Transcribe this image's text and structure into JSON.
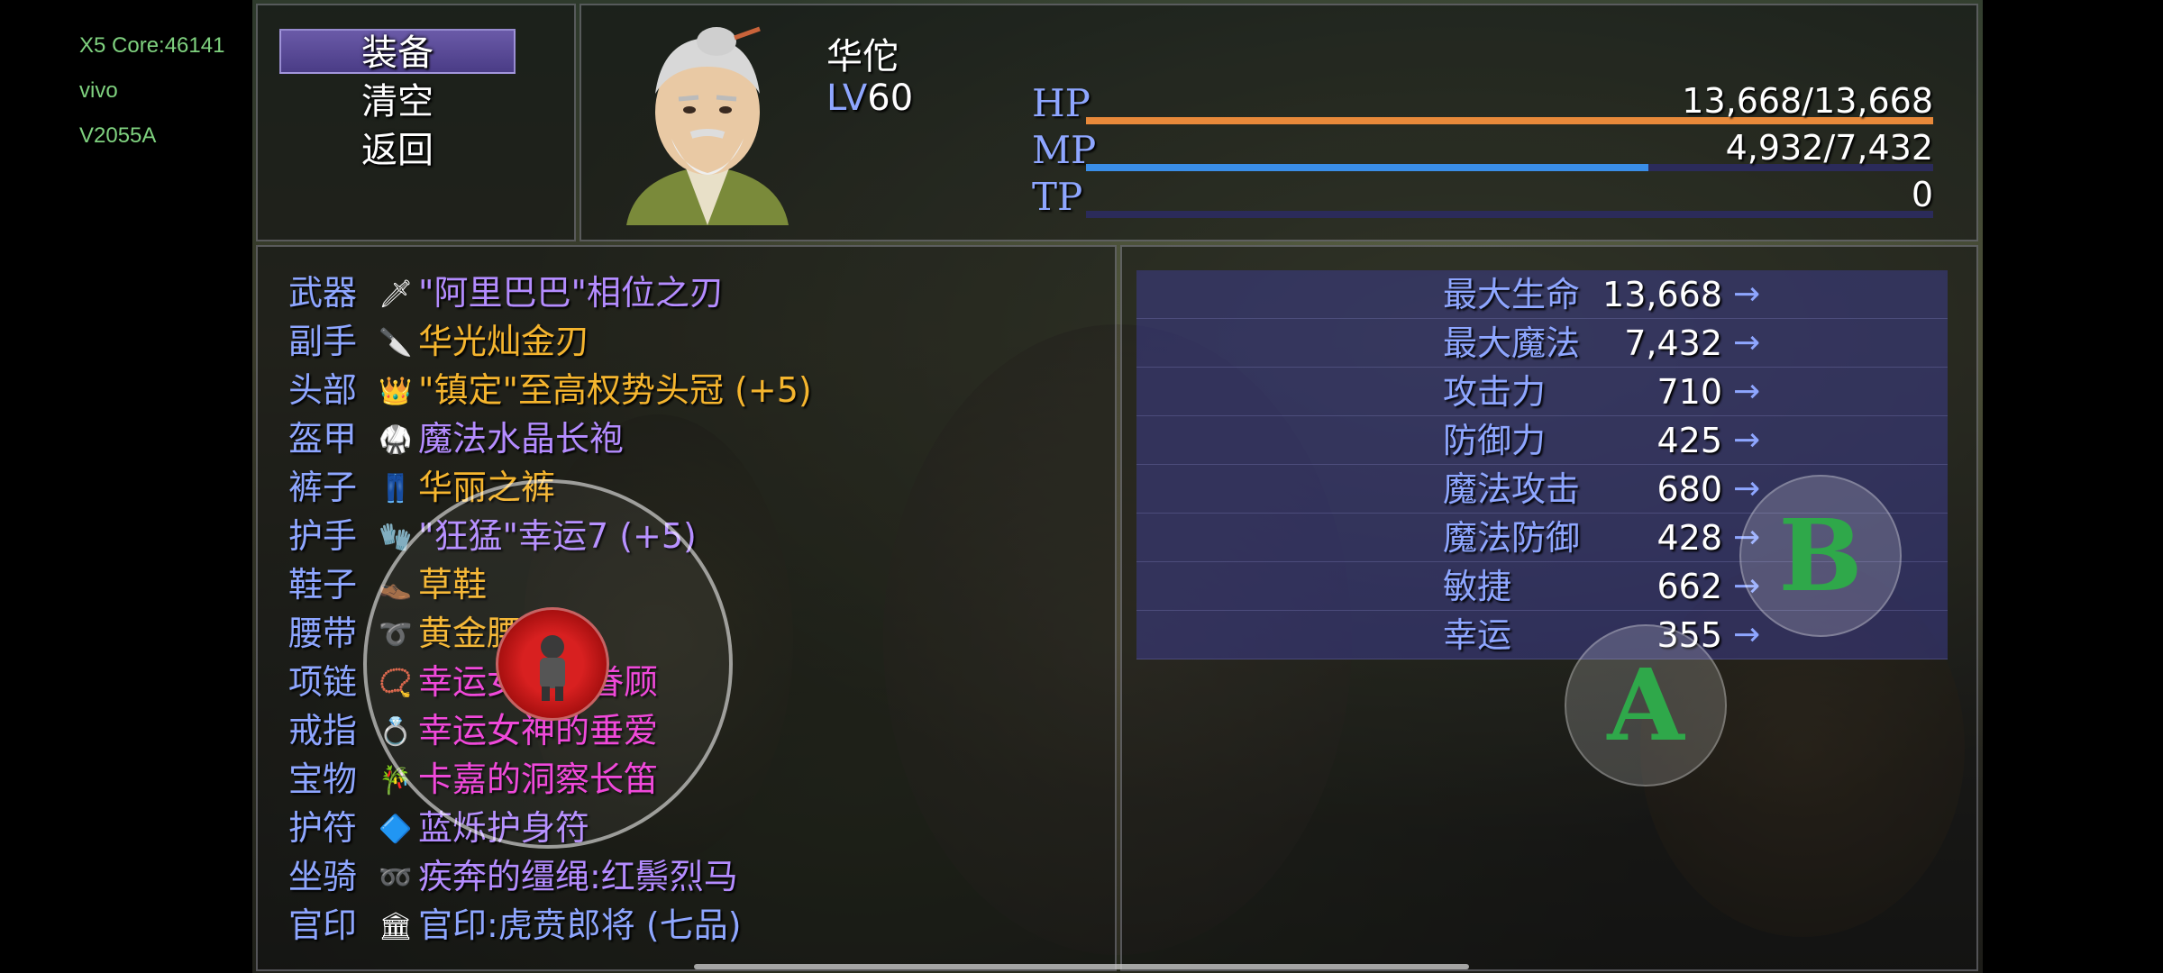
{
  "device_info": {
    "lines": [
      "X5 Core:46141",
      "vivo",
      "V2055A"
    ]
  },
  "menu": {
    "commands": [
      {
        "label": "装备",
        "selected": true
      },
      {
        "label": "清空",
        "selected": false
      },
      {
        "label": "返回",
        "selected": false
      }
    ]
  },
  "actor": {
    "name": "华佗",
    "level_label": "LV",
    "level": "60",
    "gauges": [
      {
        "label": "HP",
        "value": "13,668/13,668",
        "fill": 1.0,
        "color": "#e8893a"
      },
      {
        "label": "MP",
        "value": "4,932/7,432",
        "fill": 0.6636,
        "color": "#3a8ee8"
      },
      {
        "label": "TP",
        "value": "0",
        "fill": 0.0,
        "color": "#3ae87a"
      }
    ]
  },
  "equipment": {
    "slots": [
      {
        "slot": "武器",
        "icon": "sword-icon",
        "glyph": "🗡",
        "item": "\"阿里巴巴\"相位之刃",
        "color": "#b48cff"
      },
      {
        "slot": "副手",
        "icon": "blade-icon",
        "glyph": "🔪",
        "item": "华光灿金刃",
        "color": "#f5b52e"
      },
      {
        "slot": "头部",
        "icon": "crown-icon",
        "glyph": "👑",
        "item": "\"镇定\"至高权势头冠 (+5)",
        "color": "#f5b52e"
      },
      {
        "slot": "盔甲",
        "icon": "robe-icon",
        "glyph": "🥋",
        "item": "魔法水晶长袍",
        "color": "#b48cff"
      },
      {
        "slot": "裤子",
        "icon": "pants-icon",
        "glyph": "👖",
        "item": "华丽之裤",
        "color": "#f5b52e"
      },
      {
        "slot": "护手",
        "icon": "gauntlet-icon",
        "glyph": "🧤",
        "item": "\"狂猛\"幸运7 (+5)",
        "color": "#b48cff"
      },
      {
        "slot": "鞋子",
        "icon": "shoes-icon",
        "glyph": "👞",
        "item": "草鞋",
        "color": "#f5b52e"
      },
      {
        "slot": "腰带",
        "icon": "belt-icon",
        "glyph": "➰",
        "item": "黄金腰包",
        "color": "#f5b52e"
      },
      {
        "slot": "项链",
        "icon": "necklace-icon",
        "glyph": "📿",
        "item": "幸运女神的眷顾",
        "color": "#f040d8"
      },
      {
        "slot": "戒指",
        "icon": "ring-icon",
        "glyph": "💍",
        "item": "幸运女神的垂爱",
        "color": "#f040d8"
      },
      {
        "slot": "宝物",
        "icon": "flute-icon",
        "glyph": "🎋",
        "item": "卡嘉的洞察长笛",
        "color": "#f040d8"
      },
      {
        "slot": "护符",
        "icon": "amulet-icon",
        "glyph": "🔷",
        "item": "蓝烁护身符",
        "color": "#b48cff"
      },
      {
        "slot": "坐骑",
        "icon": "rein-icon",
        "glyph": "➿",
        "item": "疾奔的缰绳:红鬃烈马",
        "color": "#b48cff"
      },
      {
        "slot": "官印",
        "icon": "seal-icon",
        "glyph": "🏛",
        "item": "官印:虎贲郎将 (七品)",
        "color": "#8ea6ff"
      }
    ]
  },
  "parameters": {
    "arrow": "→",
    "rows": [
      {
        "name": "最大生命",
        "value": "13,668"
      },
      {
        "name": "最大魔法",
        "value": "7,432"
      },
      {
        "name": "攻击力",
        "value": "710"
      },
      {
        "name": "防御力",
        "value": "425"
      },
      {
        "name": "魔法攻击",
        "value": "680"
      },
      {
        "name": "魔法防御",
        "value": "428"
      },
      {
        "name": "敏捷",
        "value": "662"
      },
      {
        "name": "幸运",
        "value": "355"
      }
    ]
  },
  "virtual_buttons": {
    "b_label": "B",
    "a_label": "A"
  }
}
